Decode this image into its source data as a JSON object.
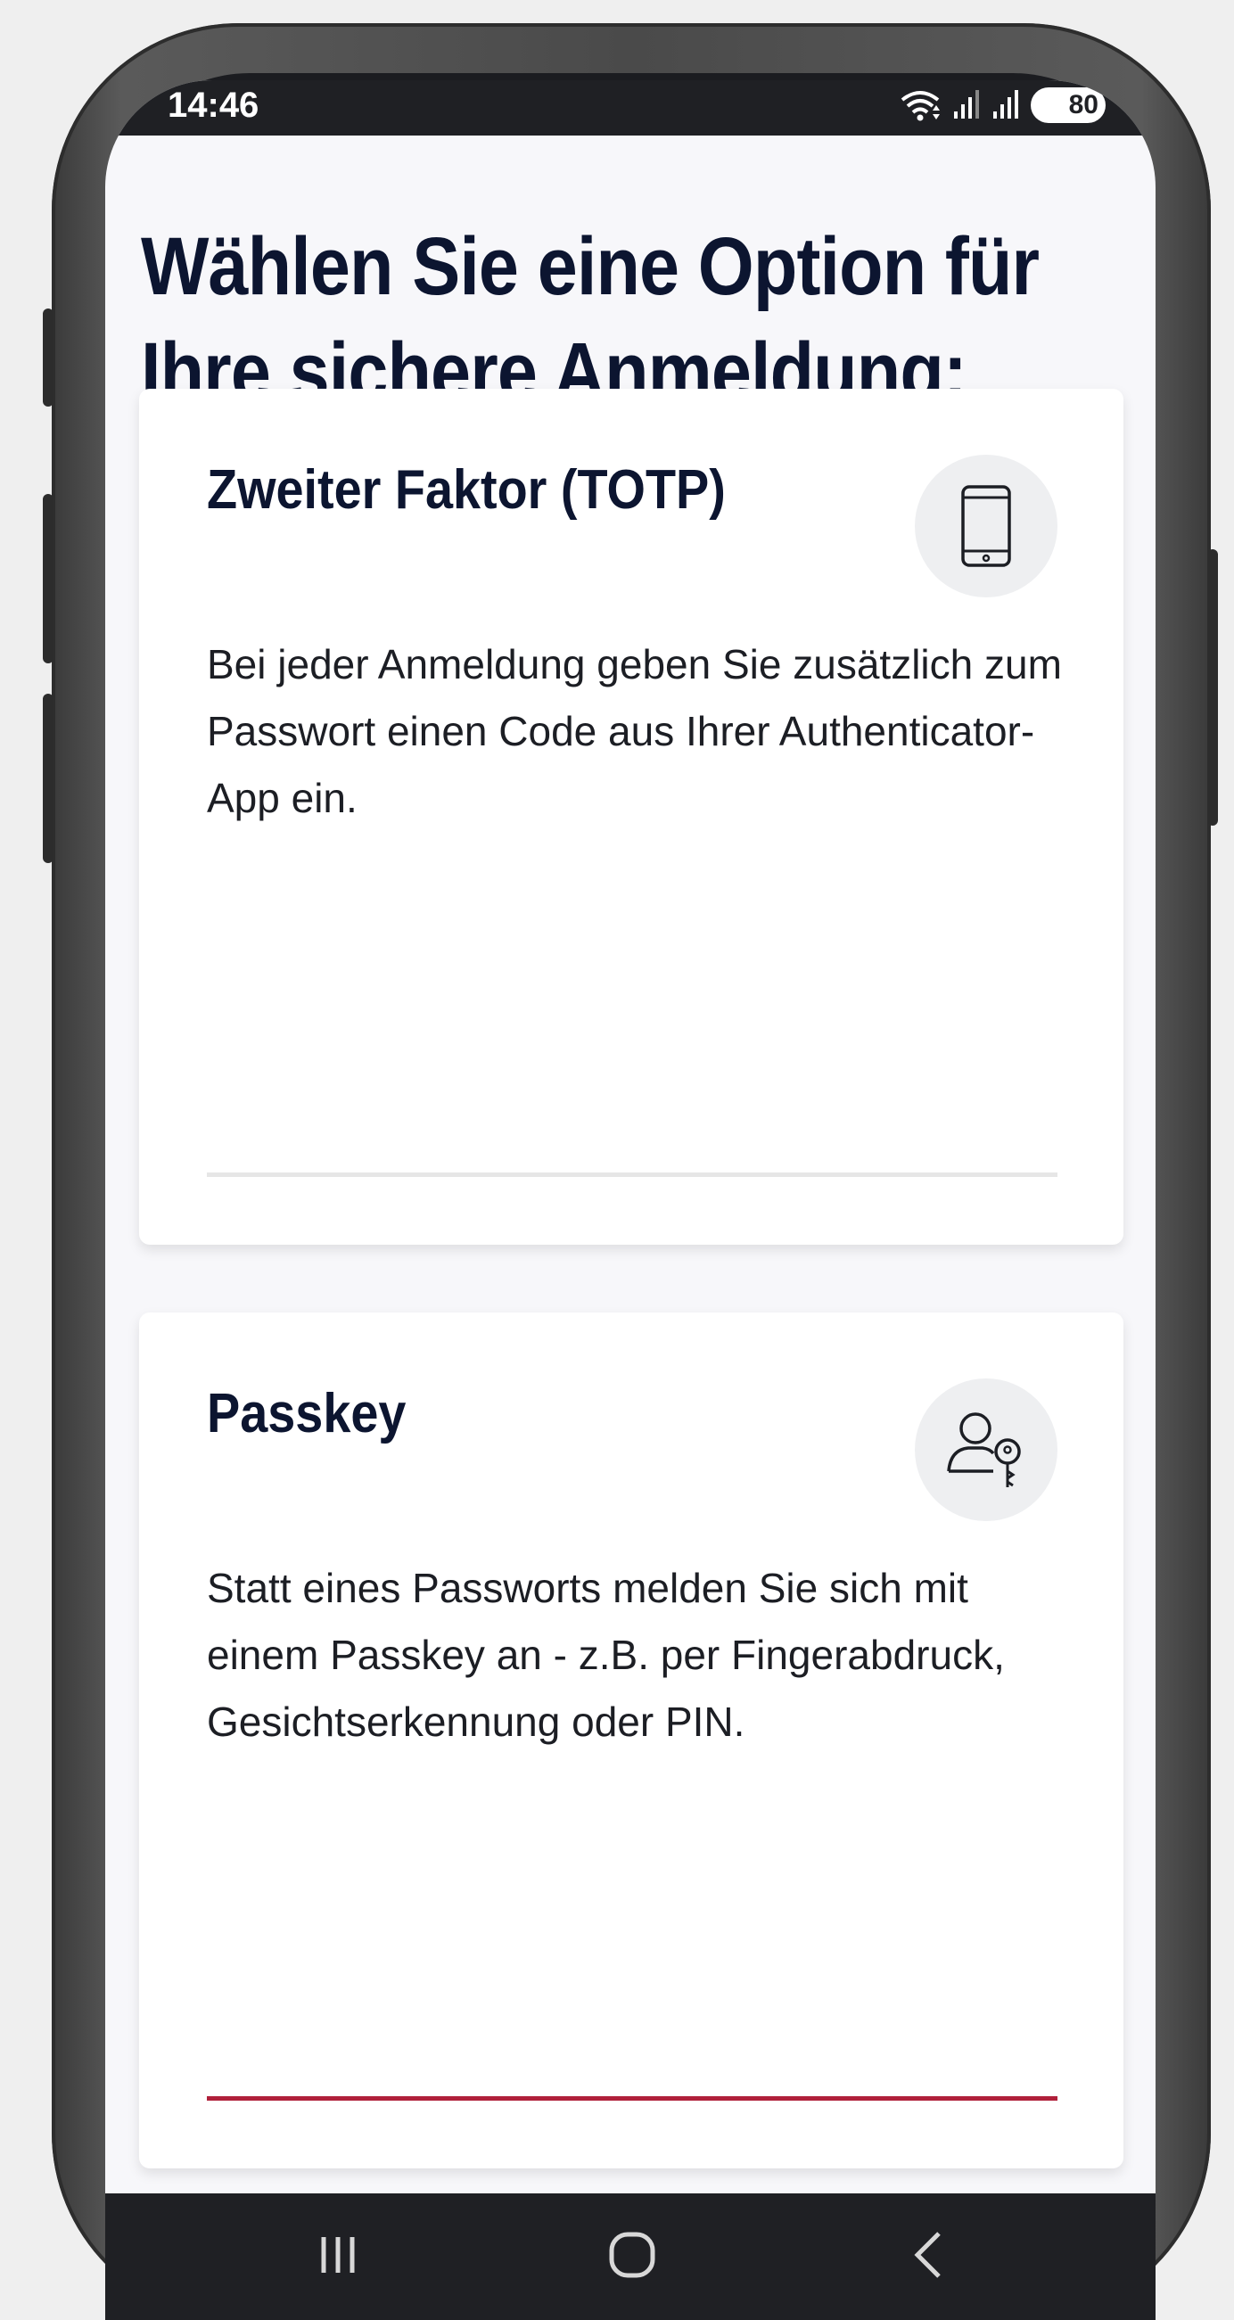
{
  "status_bar": {
    "time": "14:46",
    "battery": "80",
    "wifi_icon": "wifi-icon",
    "signal_icons": [
      "signal-icon",
      "signal-icon"
    ]
  },
  "page": {
    "heading_line1": "Wählen Sie eine Option für",
    "heading_line2": "Ihre sichere Anmeldung:"
  },
  "options": [
    {
      "title": "Zweiter Faktor (TOTP)",
      "description": "Bei jeder Anmeldung geben Sie zusätzlich zum Passwort einen Code aus Ihrer Authenticator-App ein.",
      "icon": "smartphone-icon",
      "accent_color": "#e6e6e6"
    },
    {
      "title": "Passkey",
      "description": "Statt eines Passworts melden Sie sich mit einem Passkey an - z.B. per Fingerabdruck, Gesichtserkennung oder PIN.",
      "icon": "user-key-icon",
      "accent_color": "#b0203a"
    }
  ],
  "nav_bar": {
    "recent_icon": "recent-apps-icon",
    "home_icon": "home-icon",
    "back_icon": "back-icon"
  },
  "colors": {
    "heading": "#0c1530",
    "passkey_accent": "#b0203a",
    "background": "#f7f7fa"
  }
}
